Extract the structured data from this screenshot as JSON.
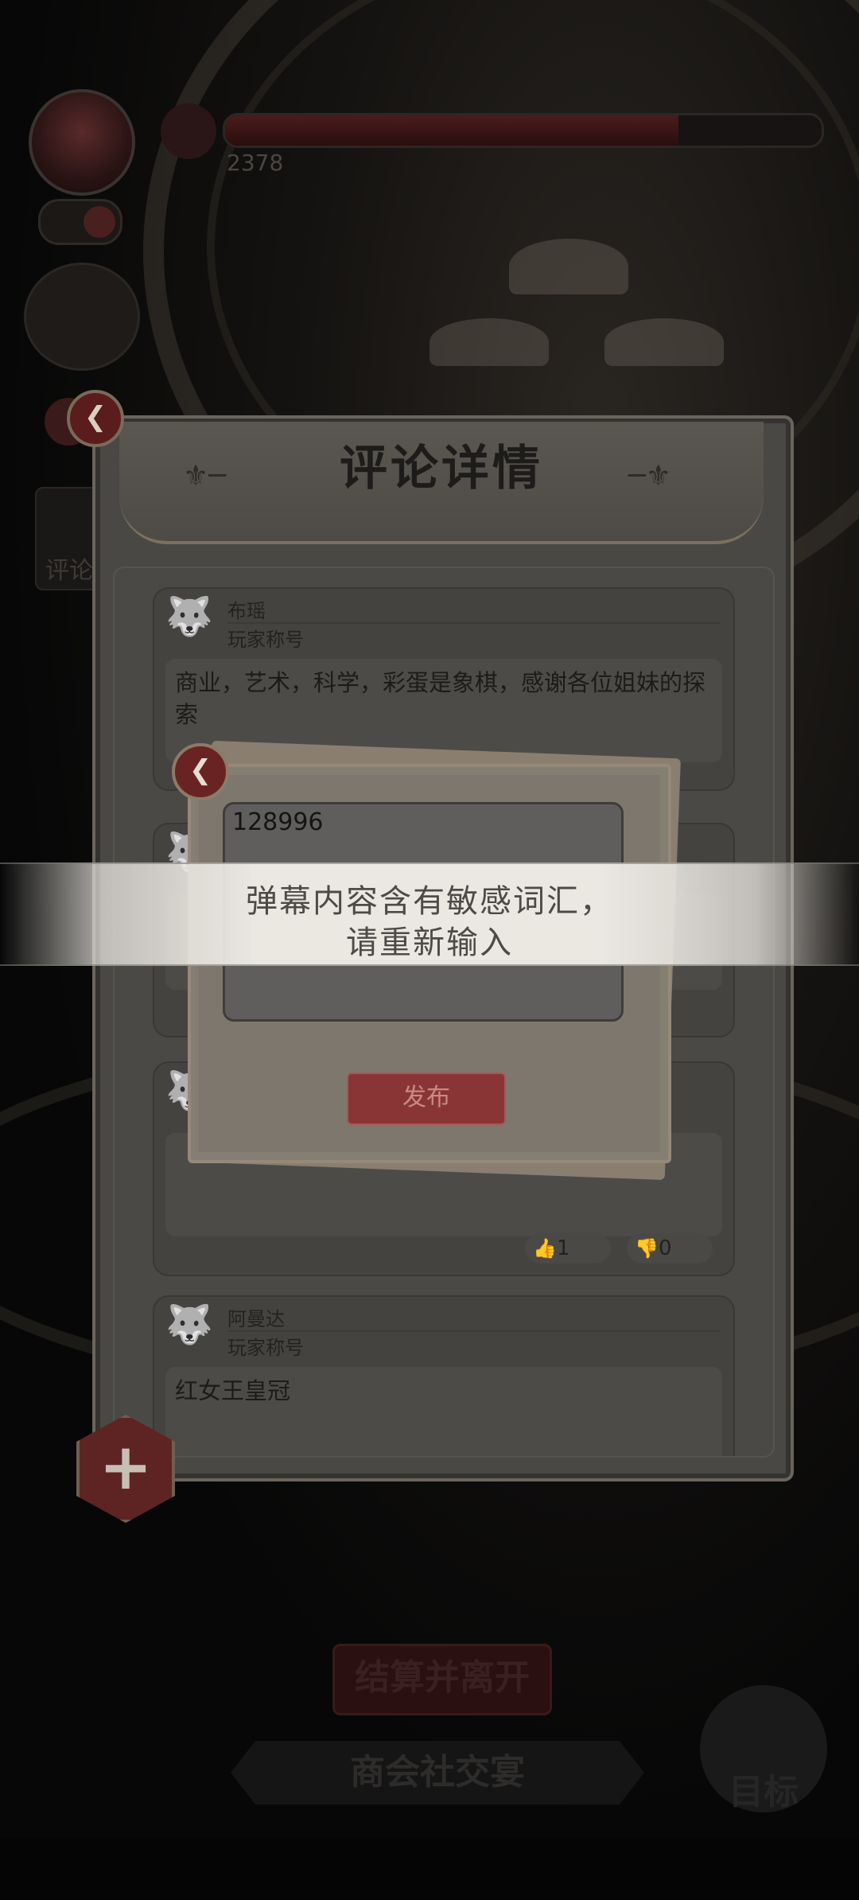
{
  "hud": {
    "hp_value": "2378",
    "hp_fraction": 0.76,
    "side_tab_label": "评论"
  },
  "panel": {
    "title": "评论详情",
    "comments": [
      {
        "name": "布瑶",
        "player_title": "玩家称号",
        "text": "商业，艺术，科学，彩蛋是象棋，感谢各位姐妹的探索",
        "likes": "",
        "dislikes": ""
      },
      {
        "name": "",
        "player_title": "",
        "text": "",
        "likes": "",
        "dislikes": ""
      },
      {
        "name": "",
        "player_title": "",
        "text": "",
        "likes": "1",
        "dislikes": "0"
      },
      {
        "name": "阿曼达",
        "player_title": "玩家称号",
        "text": "红女王皇冠",
        "likes": "",
        "dislikes": ""
      }
    ]
  },
  "dialog": {
    "input_value": "128996",
    "publish_label": "发布"
  },
  "toast": {
    "line1": "弹幕内容含有敏感词汇，",
    "line2": "请重新输入"
  },
  "bottom": {
    "settle_label": "结算并离开",
    "banner_label": "商会社交宴",
    "goal_label": "目标"
  },
  "icons": {
    "back": "back-arrow-icon",
    "close": "close-icon",
    "add": "plus-icon",
    "like": "thumbs-up-icon",
    "dislike": "thumbs-down-icon"
  },
  "colors": {
    "accent_red": "#8a3535",
    "toast_bg": "#ebe8e2",
    "toast_text": "#4d4b47"
  }
}
